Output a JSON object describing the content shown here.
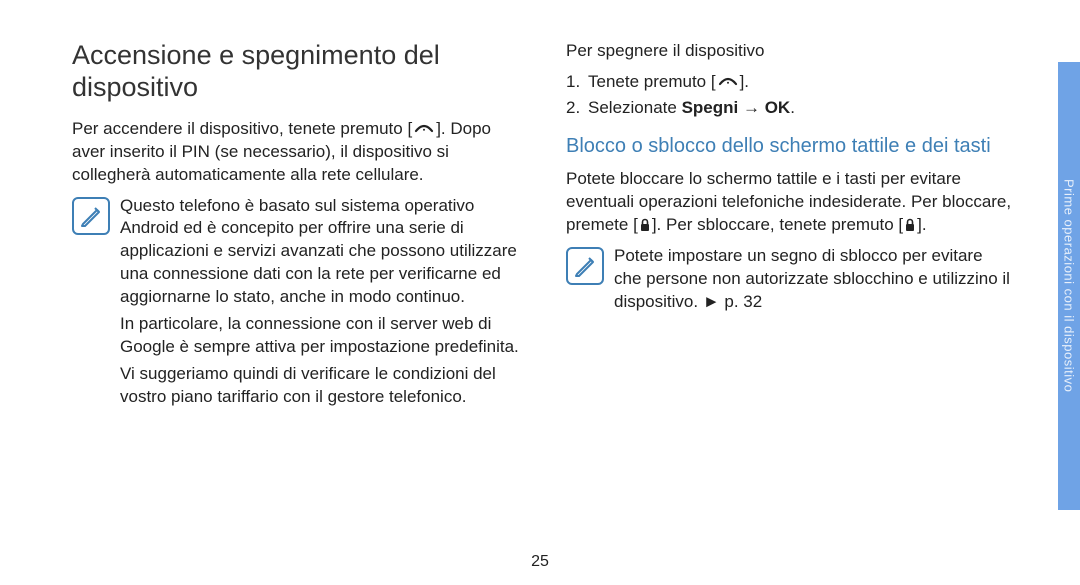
{
  "left": {
    "heading": "Accensione e spegnimento del dispositivo",
    "p1a": "Per accendere il dispositivo, tenete premuto [",
    "p1b": "]. Dopo aver inserito il PIN (se necessario), il dispositivo si collegherà automaticamente alla rete cellulare.",
    "note": {
      "p1": "Questo telefono è basato sul sistema operativo Android ed è concepito per offrire una serie di applicazioni e servizi avanzati che possono utilizzare una connessione dati con la rete per verificarne ed aggiornarne lo stato, anche in modo continuo.",
      "p2": "In particolare, la connessione con il server web di Google è sempre attiva per impostazione predefinita.",
      "p3": "Vi suggeriamo quindi di verificare le condizioni del vostro piano tariffario con il gestore telefonico."
    }
  },
  "right": {
    "intro": "Per spegnere il dispositivo",
    "step1a": "Tenete premuto [",
    "step1b": "].",
    "step2a": "Selezionate ",
    "step2b": "Spegni",
    "step2c": " → ",
    "step2d": "OK",
    "step2e": ".",
    "heading2": "Blocco o sblocco dello schermo tattile e dei tasti",
    "p2a": "Potete bloccare lo schermo tattile e i tasti per evitare eventuali operazioni telefoniche indesiderate. Per bloccare, premete [",
    "p2b": "]. Per sbloccare, tenete premuto [",
    "p2c": "].",
    "note": {
      "text": "Potete impostare un segno di sblocco per evitare che persone non autorizzate sblocchino e utilizzino il dispositivo. ► p. 32"
    }
  },
  "sidebar": "Prime operazioni con il dispositivo",
  "page_number": "25"
}
